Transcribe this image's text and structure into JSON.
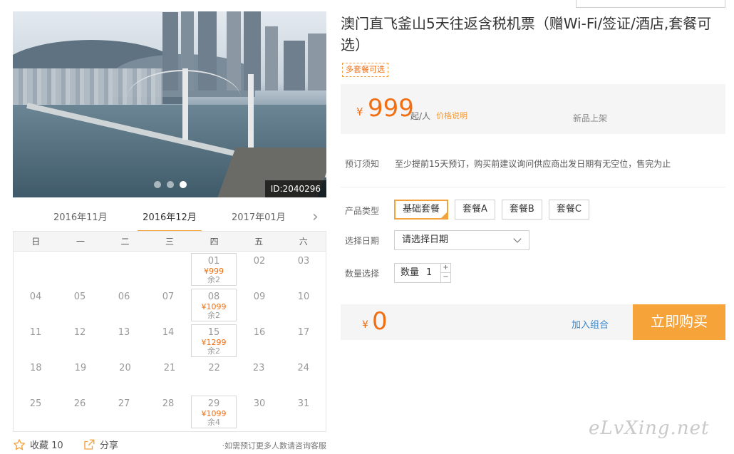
{
  "photo": {
    "id_label": "ID:2040296",
    "slide_count": 3,
    "active_slide": 3
  },
  "calendar": {
    "months": [
      "2016年11月",
      "2016年12月",
      "2017年01月"
    ],
    "active_month": "2016年12月",
    "weekdays": [
      "日",
      "一",
      "二",
      "三",
      "四",
      "五",
      "六"
    ],
    "weeks": [
      [
        {
          "day": ""
        },
        {
          "day": ""
        },
        {
          "day": ""
        },
        {
          "day": ""
        },
        {
          "day": "01",
          "price": "¥999",
          "left": "余2"
        },
        {
          "day": "02"
        },
        {
          "day": "03"
        }
      ],
      [
        {
          "day": "04"
        },
        {
          "day": "05"
        },
        {
          "day": "06"
        },
        {
          "day": "07"
        },
        {
          "day": "08",
          "price": "¥1099",
          "left": "余2"
        },
        {
          "day": "09"
        },
        {
          "day": "10"
        }
      ],
      [
        {
          "day": "11"
        },
        {
          "day": "12"
        },
        {
          "day": "13"
        },
        {
          "day": "14"
        },
        {
          "day": "15",
          "price": "¥1299",
          "left": "余2"
        },
        {
          "day": "16"
        },
        {
          "day": "17"
        }
      ],
      [
        {
          "day": "18"
        },
        {
          "day": "19"
        },
        {
          "day": "20"
        },
        {
          "day": "21"
        },
        {
          "day": "22"
        },
        {
          "day": "23"
        },
        {
          "day": "24"
        }
      ],
      [
        {
          "day": "25"
        },
        {
          "day": "26"
        },
        {
          "day": "27"
        },
        {
          "day": "28"
        },
        {
          "day": "29",
          "price": "¥1099",
          "left": "余4"
        },
        {
          "day": "30"
        },
        {
          "day": "31"
        }
      ]
    ]
  },
  "footer": {
    "favorite_label": "收藏 10",
    "share_label": "分享",
    "consult_text": "如需预订更多人数请咨询客服"
  },
  "product": {
    "title": "澳门直飞釜山5天往返含税机票（赠Wi-Fi/签证/酒店,套餐可选）",
    "tag": "多套餐可选",
    "currency": "¥",
    "price": "999",
    "unit": "起/人",
    "price_note": "价格说明",
    "status": "新品上架",
    "notice_label": "预订须知",
    "notice_text": "至少提前15天预订，购买前建议询问供应商出发日期有无空位，售完为止",
    "package_label": "产品类型",
    "packages": [
      "基础套餐",
      "套餐A",
      "套餐B",
      "套餐C"
    ],
    "selected_package": "基础套餐",
    "date_label": "选择日期",
    "date_placeholder": "请选择日期",
    "qty_label": "数量选择",
    "qty_prefix": "数量",
    "qty_value": "1",
    "qty_plus": "+",
    "qty_minus": "−",
    "total_currency": "¥",
    "total": "0",
    "add_combo": "加入组合",
    "buy_now": "立即购买"
  },
  "watermark": "eLvXing.net",
  "colors": {
    "accent": "#f26e12",
    "button": "#f6a33a",
    "link": "#3b86c6"
  }
}
